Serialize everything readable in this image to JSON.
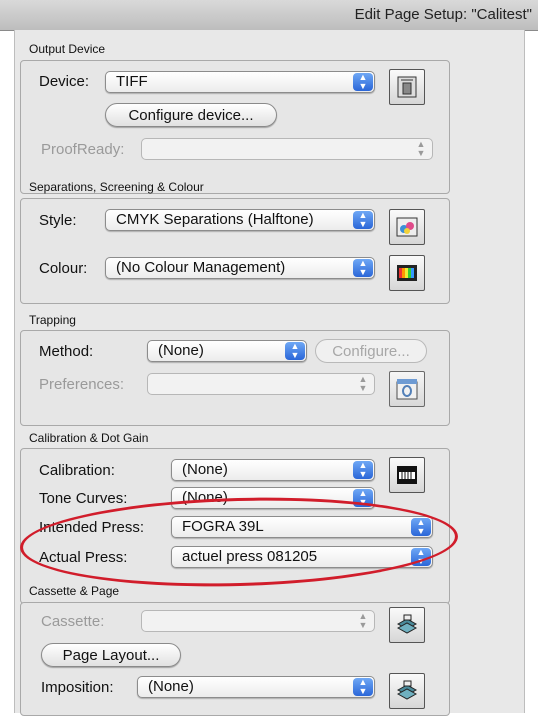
{
  "window": {
    "title": "Edit Page Setup: \"Calitest\""
  },
  "output_device": {
    "section_title": "Output Device",
    "device_label": "Device:",
    "device_value": "TIFF",
    "configure_button": "Configure device...",
    "proofready_label": "ProofReady:",
    "proofready_value": ""
  },
  "separations": {
    "section_title": "Separations, Screening & Colour",
    "style_label": "Style:",
    "style_value": "CMYK Separations (Halftone)",
    "colour_label": "Colour:",
    "colour_value": "(No Colour Management)"
  },
  "trapping": {
    "section_title": "Trapping",
    "method_label": "Method:",
    "method_value": "(None)",
    "configure_button": "Configure...",
    "preferences_label": "Preferences:",
    "preferences_value": ""
  },
  "calibration": {
    "section_title": "Calibration & Dot Gain",
    "calibration_label": "Calibration:",
    "calibration_value": "(None)",
    "tone_curves_label": "Tone Curves:",
    "tone_curves_value": "(None)",
    "intended_press_label": "Intended Press:",
    "intended_press_value": "FOGRA 39L",
    "actual_press_label": "Actual Press:",
    "actual_press_value": "actuel press 081205"
  },
  "cassette": {
    "section_title": "Cassette & Page",
    "cassette_label": "Cassette:",
    "cassette_value": "",
    "page_layout_button": "Page Layout...",
    "imposition_label": "Imposition:",
    "imposition_value": "(None)"
  },
  "annotation": {
    "color": "#d11d2b"
  },
  "colors": {
    "popup_arrow": "#2a66d8",
    "group_border": "#a9a9a9"
  }
}
